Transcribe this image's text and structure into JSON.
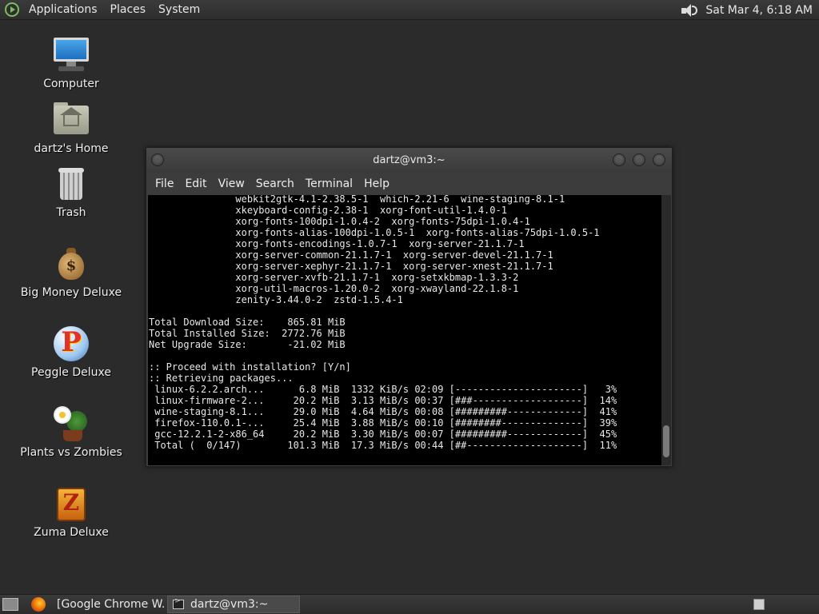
{
  "top_panel": {
    "menus": [
      "Applications",
      "Places",
      "System"
    ],
    "clock": "Sat Mar  4,  6:18 AM"
  },
  "desktop_icons": [
    {
      "label": "Computer",
      "icon": "computer-icon"
    },
    {
      "label": "dartz's Home",
      "icon": "home-folder-icon"
    },
    {
      "label": "Trash",
      "icon": "trash-icon"
    },
    {
      "label": "Big Money Deluxe",
      "icon": "money-bag-icon"
    },
    {
      "label": "Peggle Deluxe",
      "icon": "peggle-icon"
    },
    {
      "label": "Plants vs Zombies",
      "icon": "plants-icon"
    },
    {
      "label": "Zuma Deluxe",
      "icon": "zuma-icon"
    }
  ],
  "terminal": {
    "title": "dartz@vm3:~",
    "menu": [
      "File",
      "Edit",
      "View",
      "Search",
      "Terminal",
      "Help"
    ],
    "lines": [
      "               webkit2gtk-4.1-2.38.5-1  which-2.21-6  wine-staging-8.1-1",
      "               xkeyboard-config-2.38-1  xorg-font-util-1.4.0-1",
      "               xorg-fonts-100dpi-1.0.4-2  xorg-fonts-75dpi-1.0.4-1",
      "               xorg-fonts-alias-100dpi-1.0.5-1  xorg-fonts-alias-75dpi-1.0.5-1",
      "               xorg-fonts-encodings-1.0.7-1  xorg-server-21.1.7-1",
      "               xorg-server-common-21.1.7-1  xorg-server-devel-21.1.7-1",
      "               xorg-server-xephyr-21.1.7-1  xorg-server-xnest-21.1.7-1",
      "               xorg-server-xvfb-21.1.7-1  xorg-setxkbmap-1.3.3-2",
      "               xorg-util-macros-1.20.0-2  xorg-xwayland-22.1.8-1",
      "               zenity-3.44.0-2  zstd-1.5.4-1",
      "",
      "Total Download Size:    865.81 MiB",
      "Total Installed Size:  2772.76 MiB",
      "Net Upgrade Size:       -21.02 MiB",
      "",
      ":: Proceed with installation? [Y/n]",
      ":: Retrieving packages...",
      " linux-6.2.2.arch...      6.8 MiB  1332 KiB/s 02:09 [----------------------]   3%",
      " linux-firmware-2...     20.2 MiB  3.13 MiB/s 00:37 [###-------------------]  14%",
      " wine-staging-8.1...     29.0 MiB  4.64 MiB/s 00:08 [#########-------------]  41%",
      " firefox-110.0.1-...     25.4 MiB  3.88 MiB/s 00:10 [########--------------]  39%",
      " gcc-12.2.1-2-x86_64     20.2 MiB  3.30 MiB/s 00:07 [#########-------------]  45%",
      " Total (  0/147)        101.3 MiB  17.3 MiB/s 00:44 [##--------------------]  11%"
    ]
  },
  "taskbar": {
    "tasks": [
      "[Google Chrome W...",
      "dartz@vm3:~"
    ]
  }
}
